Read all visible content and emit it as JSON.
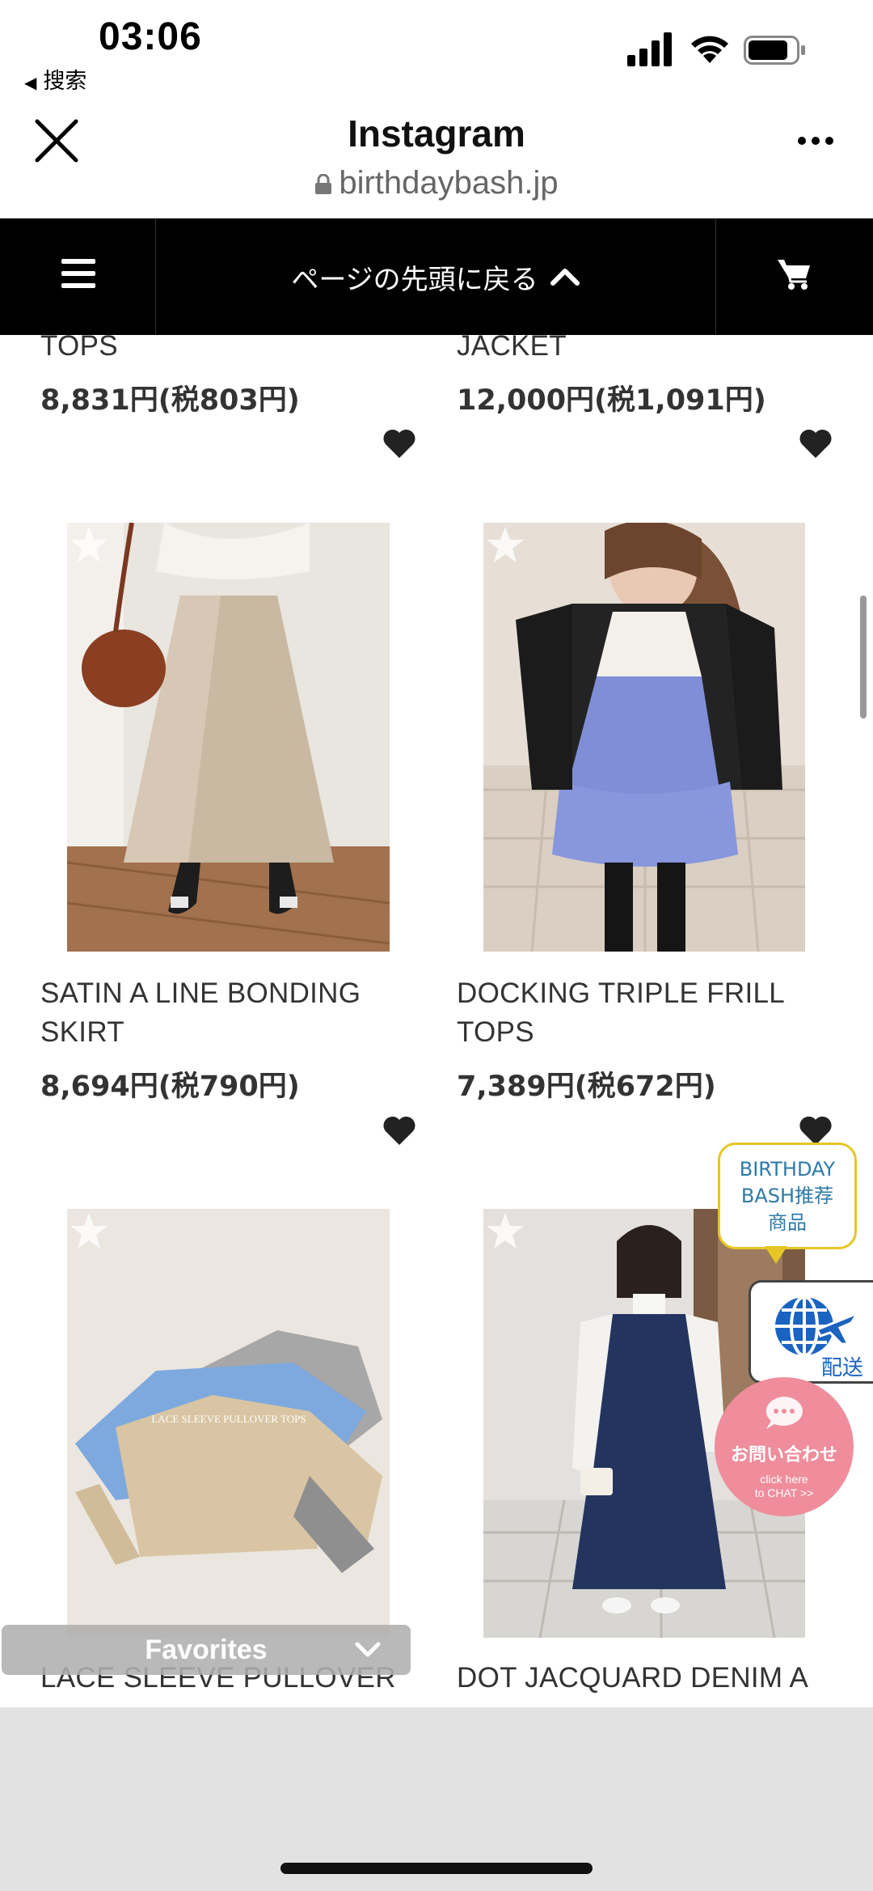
{
  "status_bar": {
    "time": "03:06",
    "back_app": "搜索"
  },
  "browser": {
    "title": "Instagram",
    "url": "birthdaybash.jp"
  },
  "site_nav": {
    "back_to_top": "ページの先頭に戻る"
  },
  "products": [
    {
      "name": "TOPS",
      "price": "8,831円(税803円)"
    },
    {
      "name": "JACKET",
      "price": "12,000円(税1,091円)"
    },
    {
      "name_line1": "SATIN A LINE BONDING",
      "name_line2": "SKIRT",
      "price": "8,694円(税790円)"
    },
    {
      "name_line1": "DOCKING TRIPLE FRILL",
      "name_line2": "TOPS",
      "price": "7,389円(税672円)"
    },
    {
      "name": "LACE SLEEVE PULLOVER",
      "photo_text": "LACE SLEEVE PULLOVER TOPS"
    },
    {
      "name": "DOT JACQUARD DENIM A"
    }
  ],
  "widgets": {
    "recommend_line1": "BIRTHDAY",
    "recommend_line2": "BASH推荐",
    "recommend_line3": "商品",
    "shipping_label": "配送",
    "chat_main": "お問い合わせ",
    "chat_sub1": "click here",
    "chat_sub2": "to CHAT >>",
    "favorites": "Favorites"
  },
  "colors": {
    "nav_bg": "#000000",
    "chat_pink": "#ef8d9c",
    "bubble_border": "#e6c624",
    "bubble_text": "#2d7aa6"
  }
}
